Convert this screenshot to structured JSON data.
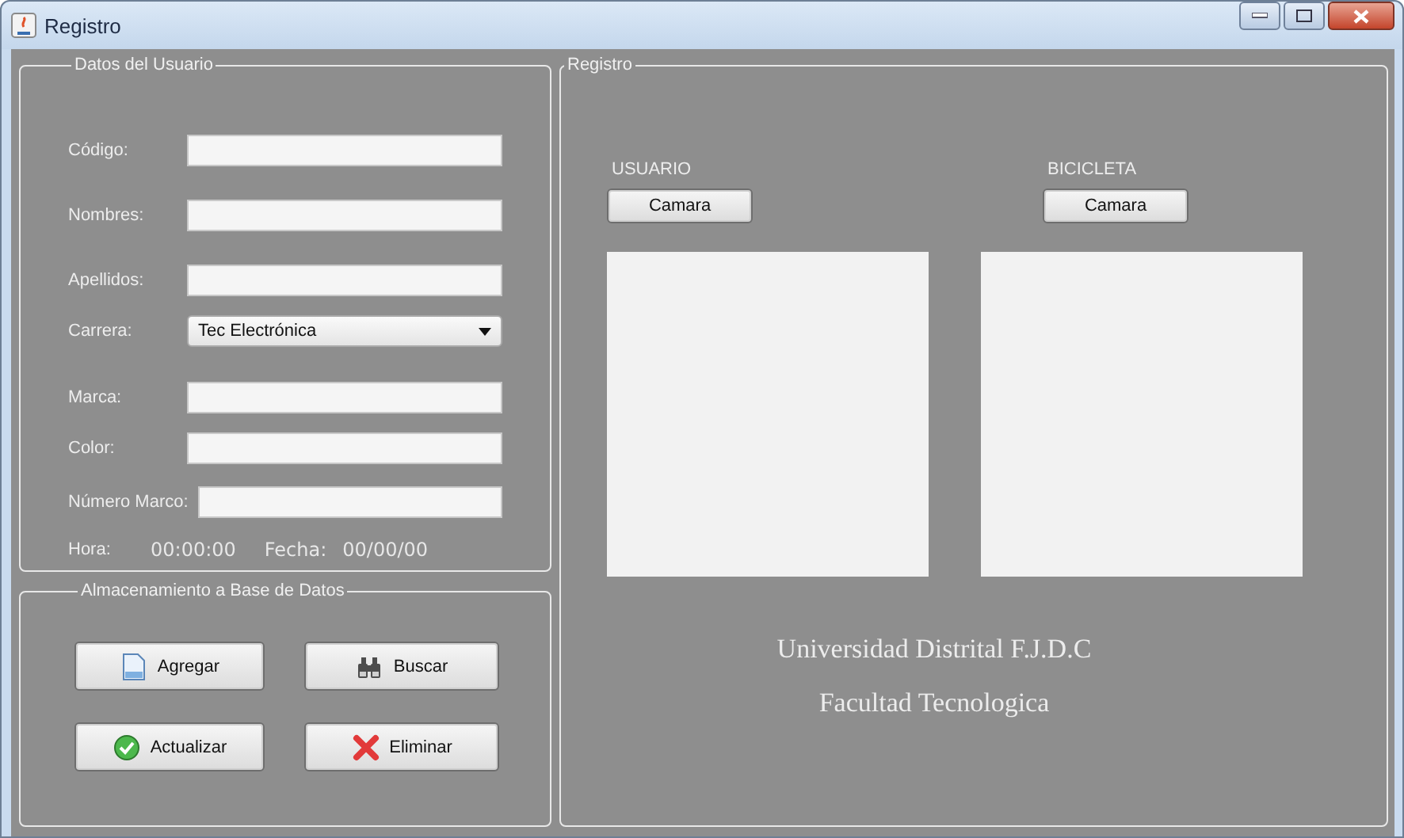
{
  "window": {
    "title": "Registro"
  },
  "user_group": {
    "title": "Datos del Usuario",
    "fields": [
      {
        "kind": "text",
        "label": "Código:"
      },
      {
        "kind": "text",
        "label": "Nombres:"
      },
      {
        "kind": "text",
        "label": "Apellidos:"
      },
      {
        "kind": "combo",
        "label": "Carrera:",
        "value": "Tec Electrónica"
      },
      {
        "kind": "text",
        "label": "Marca:"
      },
      {
        "kind": "text",
        "label": "Color:"
      },
      {
        "kind": "text",
        "label": "Número Marco:"
      }
    ],
    "time": {
      "label": "Hora:",
      "value": "00:00:00"
    },
    "date": {
      "label": "Fecha:",
      "value": "00/00/00"
    }
  },
  "storage_group": {
    "title": "Almacenamiento a Base de Datos",
    "buttons": [
      {
        "label": "Agregar"
      },
      {
        "label": "Buscar"
      },
      {
        "label": "Actualizar"
      },
      {
        "label": "Eliminar"
      }
    ]
  },
  "register_group": {
    "title": "Registro",
    "cameras": [
      {
        "label": "USUARIO",
        "button": "Camara"
      },
      {
        "label": "BICICLETA",
        "button": "Camara"
      }
    ],
    "footer_lines": [
      "Universidad Distrital F.J.D.C",
      "Facultad Tecnologica"
    ]
  }
}
